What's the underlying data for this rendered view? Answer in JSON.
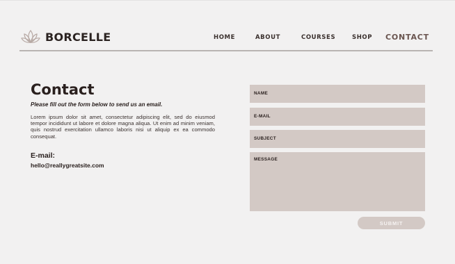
{
  "brand": {
    "logo_icon": "lotus-icon",
    "name": "BORCELLE"
  },
  "nav": {
    "items": [
      {
        "label": "HOME"
      },
      {
        "label": "ABOUT"
      },
      {
        "label": "COURSES"
      },
      {
        "label": "SHOP"
      },
      {
        "label": "CONTACT",
        "active": true
      }
    ]
  },
  "contact": {
    "title": "Contact",
    "subtitle": "Please fill out the form below to send us an email.",
    "body": "Lorem ipsum dolor sit amet, consectetur adipiscing elit, sed do eiusmod tempor incididunt ut labore et dolore magna aliqua. Ut enim ad minim veniam, quis nostrud exercitation ullamco laboris nisi ut aliquip ex ea commodo consequat.",
    "email_label": "E-mail:",
    "email_value": "hello@reallygreatsite.com"
  },
  "form": {
    "name_label": "NAME",
    "email_label": "E-MAIL",
    "subject_label": "SUBJECT",
    "message_label": "MESSAGE",
    "submit_label": "SUBMIT"
  },
  "colors": {
    "background": "#f2f1f1",
    "field": "#d3c9c5",
    "text": "#2a201e",
    "accent": "#6a5550"
  }
}
